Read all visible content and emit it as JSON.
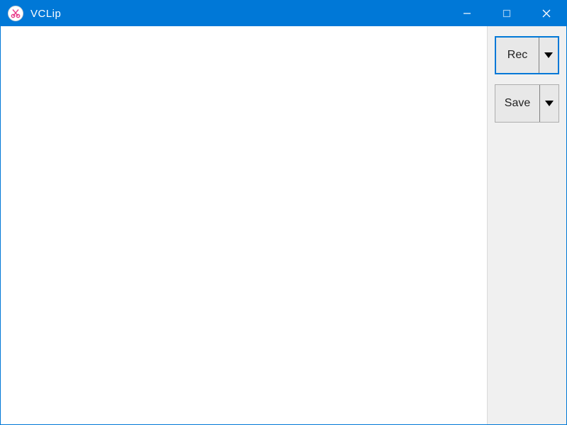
{
  "window": {
    "title": "VCLip"
  },
  "toolbar": {
    "rec_label": "Rec",
    "save_label": "Save"
  },
  "colors": {
    "accent": "#0078d7",
    "panel_bg": "#f0f0f0",
    "button_bg": "#e8e8e8"
  }
}
